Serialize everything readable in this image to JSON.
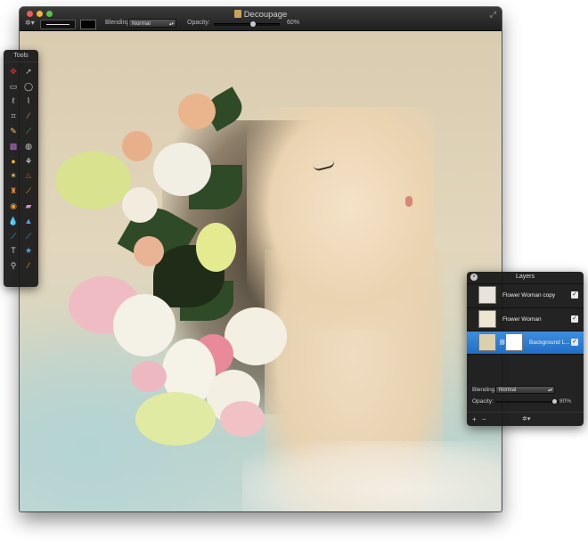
{
  "window": {
    "title": "Decoupage"
  },
  "toolbar": {
    "blending_label": "Blending:",
    "blending_value": "Normal",
    "opacity_label": "Opacity:",
    "opacity_value": "60%",
    "opacity_fraction": 0.6
  },
  "tools_panel": {
    "title": "Tools",
    "tools": [
      {
        "icon": "move-icon",
        "glyph": "✥",
        "color": "#c33"
      },
      {
        "icon": "arrow-icon",
        "glyph": "➚",
        "color": "#bbb"
      },
      {
        "icon": "rect-select-icon",
        "glyph": "▭",
        "color": "#ccc"
      },
      {
        "icon": "ellipse-select-icon",
        "glyph": "◯",
        "color": "#ccc"
      },
      {
        "icon": "lasso-icon",
        "glyph": "ℓ",
        "color": "#ccc"
      },
      {
        "icon": "polygon-lasso-icon",
        "glyph": "⌇",
        "color": "#ccc"
      },
      {
        "icon": "crop-icon",
        "glyph": "⌗",
        "color": "#ccc"
      },
      {
        "icon": "eyedropper-icon",
        "glyph": "⁄",
        "color": "#e8a33a"
      },
      {
        "icon": "pencil-icon",
        "glyph": "✎",
        "color": "#e9c55a"
      },
      {
        "icon": "brush-icon",
        "glyph": "⟋",
        "color": "#4cc04c"
      },
      {
        "icon": "gradient-icon",
        "glyph": "▩",
        "color": "#b56fd1"
      },
      {
        "icon": "fill-bucket-icon",
        "glyph": "◍",
        "color": "#ccc"
      },
      {
        "icon": "smudge-icon",
        "glyph": "●",
        "color": "#f0b02b"
      },
      {
        "icon": "magic-wand-icon",
        "glyph": "⚘",
        "color": "#eee"
      },
      {
        "icon": "healing-brush-icon",
        "glyph": "✶",
        "color": "#e9c55a"
      },
      {
        "icon": "burn-icon",
        "glyph": "♨",
        "color": "#e66a2c"
      },
      {
        "icon": "clone-stamp-icon",
        "glyph": "♜",
        "color": "#e68a2c"
      },
      {
        "icon": "patch-icon",
        "glyph": "⟋",
        "color": "#e9a14a"
      },
      {
        "icon": "red-eye-icon",
        "glyph": "◉",
        "color": "#e69a2c"
      },
      {
        "icon": "eraser-icon",
        "glyph": "▰",
        "color": "#d68ad8"
      },
      {
        "icon": "blur-icon",
        "glyph": "💧",
        "color": "#4aa8e8"
      },
      {
        "icon": "sharpen-icon",
        "glyph": "▲",
        "color": "#4aa8e8"
      },
      {
        "icon": "smudge-finger-icon",
        "glyph": "⟋",
        "color": "#4aa8e8"
      },
      {
        "icon": "dodge-icon",
        "glyph": "⟋",
        "color": "#4aa8e8"
      },
      {
        "icon": "text-icon",
        "glyph": "T",
        "color": "#ccc"
      },
      {
        "icon": "shape-icon",
        "glyph": "★",
        "color": "#4aa8e8"
      },
      {
        "icon": "zoom-icon",
        "glyph": "⚲",
        "color": "#ccc"
      },
      {
        "icon": "color-picker-icon",
        "glyph": "⁄",
        "color": "#e8a33a"
      }
    ]
  },
  "layers_panel": {
    "title": "Layers",
    "layers": [
      {
        "name": "Flower Woman copy",
        "visible": true,
        "selected": false
      },
      {
        "name": "Flower Woman",
        "visible": true,
        "selected": false
      },
      {
        "name": "Background L...",
        "visible": true,
        "selected": true
      }
    ],
    "blending_label": "Blending:",
    "blending_value": "Normal",
    "opacity_label": "Opacity:",
    "opacity_value": "80%",
    "opacity_fraction": 0.8
  }
}
